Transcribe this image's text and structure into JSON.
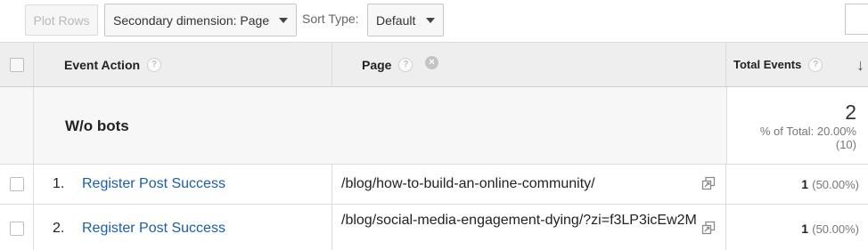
{
  "toolbar": {
    "plot_rows_label": "Plot Rows",
    "secondary_dimension_label": "Secondary dimension: Page",
    "sort_type_label": "Sort Type:",
    "sort_type_value": "Default"
  },
  "table": {
    "headers": {
      "event_action": "Event Action",
      "page": "Page",
      "total_events": "Total Events"
    },
    "help_glyph": "?",
    "remove_glyph": "×",
    "sort_glyph": "↓",
    "summary": {
      "label": "W/o bots",
      "total_value": "2",
      "total_pct_line1": "% of Total: 20.00%",
      "total_pct_line2": "(10)"
    },
    "rows": [
      {
        "index": "1.",
        "event_action": "Register Post Success",
        "page": "/blog/how-to-build-an-online-community/",
        "total_events": "1",
        "total_pct": "(50.00%)"
      },
      {
        "index": "2.",
        "event_action": "Register Post Success",
        "page": "/blog/social-media-engagement-dying/?zi=f3LP3icEw2M",
        "total_events": "1",
        "total_pct": "(50.00%)"
      }
    ]
  },
  "icons": {
    "help": "help-circle-icon",
    "remove": "remove-dimension-icon",
    "sort": "sort-descending-icon",
    "open_page": "open-external-icon"
  },
  "colors": {
    "link": "#1a5ea8",
    "header_bg": "#eeeeee",
    "summary_bg": "#f7f7f7"
  }
}
